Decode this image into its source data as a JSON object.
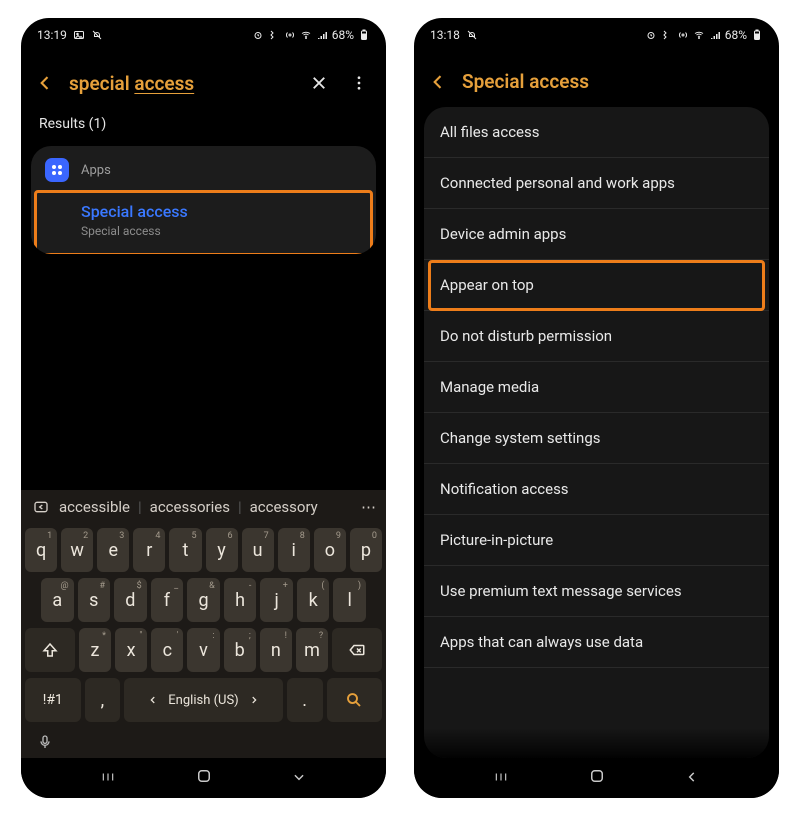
{
  "left": {
    "status": {
      "time": "13:19",
      "battery": "68%"
    },
    "search_text_plain": "special ",
    "search_text_under": "access",
    "results_label": "Results (1)",
    "result_category": "Apps",
    "result_title": "Special access",
    "result_sub": "Special access",
    "suggestions": [
      "accessible",
      "accessories",
      "accessory"
    ],
    "kb_rows": {
      "r1": [
        {
          "k": "q",
          "a": "1"
        },
        {
          "k": "w",
          "a": "2"
        },
        {
          "k": "e",
          "a": "3"
        },
        {
          "k": "r",
          "a": "4"
        },
        {
          "k": "t",
          "a": "5"
        },
        {
          "k": "y",
          "a": "6"
        },
        {
          "k": "u",
          "a": "7"
        },
        {
          "k": "i",
          "a": "8"
        },
        {
          "k": "o",
          "a": "9"
        },
        {
          "k": "p",
          "a": "0"
        }
      ],
      "r2": [
        {
          "k": "a",
          "a": "@"
        },
        {
          "k": "s",
          "a": "#"
        },
        {
          "k": "d",
          "a": "$"
        },
        {
          "k": "f",
          "a": "_"
        },
        {
          "k": "g",
          "a": "&"
        },
        {
          "k": "h",
          "a": "-"
        },
        {
          "k": "j",
          "a": "+"
        },
        {
          "k": "k",
          "a": "("
        },
        {
          "k": "l",
          "a": ")"
        }
      ],
      "r3": [
        {
          "k": "z",
          "a": "*"
        },
        {
          "k": "x",
          "a": "\""
        },
        {
          "k": "c",
          "a": "'"
        },
        {
          "k": "v",
          "a": ":"
        },
        {
          "k": "b",
          "a": ";"
        },
        {
          "k": "n",
          "a": "!"
        },
        {
          "k": "m",
          "a": "?"
        }
      ]
    },
    "sym_key": "!#1",
    "comma": ",",
    "lang": "English (US)",
    "period": "."
  },
  "right": {
    "status": {
      "time": "13:18",
      "battery": "68%"
    },
    "title": "Special access",
    "items": [
      "All files access",
      "Connected personal and work apps",
      "Device admin apps",
      "Appear on top",
      "Do not disturb permission",
      "Manage media",
      "Change system settings",
      "Notification access",
      "Picture-in-picture",
      "Use premium text message services",
      "Apps that can always use data"
    ],
    "highlight_index": 3
  }
}
